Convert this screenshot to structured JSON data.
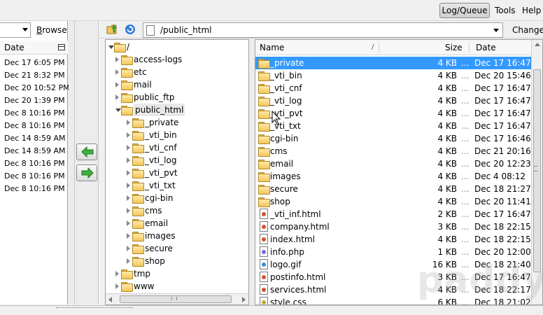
{
  "toolbar": {
    "log_queue_label": "Log/Queue",
    "tools_label": "Tools",
    "help_label": "Help"
  },
  "local_pane": {
    "browse_label": "Browse",
    "date_header": "Date",
    "dates": [
      "Dec 17 6:05 PM",
      "Dec 21 8:32 PM",
      "Dec 20 10:52 PM",
      "Dec 20 1:39 PM",
      "Dec 8 10:16 PM",
      "Dec 8 10:16 PM",
      "Dec 14 8:59 AM",
      "Dec 14 8:59 AM",
      "Dec 8 10:16 PM",
      "Dec 8 10:16 PM",
      "Dec 8 10:16 PM"
    ]
  },
  "remote": {
    "path": "/public_html",
    "change_label": "Change"
  },
  "tree": {
    "root": "/",
    "items": [
      {
        "label": "access-logs"
      },
      {
        "label": "etc"
      },
      {
        "label": "mail"
      },
      {
        "label": "public_ftp"
      },
      {
        "label": "public_html"
      },
      {
        "label": "_private"
      },
      {
        "label": "_vti_bin"
      },
      {
        "label": "_vti_cnf"
      },
      {
        "label": "_vti_log"
      },
      {
        "label": "_vti_pvt"
      },
      {
        "label": "_vti_txt"
      },
      {
        "label": "cgi-bin"
      },
      {
        "label": "cms"
      },
      {
        "label": "email"
      },
      {
        "label": "images"
      },
      {
        "label": "secure"
      },
      {
        "label": "shop"
      },
      {
        "label": "tmp"
      },
      {
        "label": "www"
      }
    ]
  },
  "file_list": {
    "headers": {
      "name": "Name",
      "size": "Size",
      "date": "Date",
      "sort_mark": "/"
    },
    "rows": [
      {
        "name": "_private",
        "size": "4 KB",
        "date": "Dec 17 16:47",
        "type": "folder"
      },
      {
        "name": "_vti_bin",
        "size": "4 KB",
        "date": "Dec 20 15:46",
        "type": "folder"
      },
      {
        "name": "_vti_cnf",
        "size": "4 KB",
        "date": "Dec 17 16:47",
        "type": "folder"
      },
      {
        "name": "_vti_log",
        "size": "4 KB",
        "date": "Dec 17 16:47",
        "type": "folder"
      },
      {
        "name": "_vti_pvt",
        "size": "4 KB",
        "date": "Dec 17 16:47",
        "type": "folder"
      },
      {
        "name": "_vti_txt",
        "size": "4 KB",
        "date": "Dec 17 16:47",
        "type": "folder"
      },
      {
        "name": "cgi-bin",
        "size": "4 KB",
        "date": "Dec 17 16:46",
        "type": "folder"
      },
      {
        "name": "cms",
        "size": "4 KB",
        "date": "Dec 21 20:16",
        "type": "folder"
      },
      {
        "name": "email",
        "size": "4 KB",
        "date": "Dec 20 12:23",
        "type": "folder"
      },
      {
        "name": "images",
        "size": "4 KB",
        "date": "Dec 4 08:12",
        "type": "folder"
      },
      {
        "name": "secure",
        "size": "4 KB",
        "date": "Dec 18 21:27",
        "type": "folder"
      },
      {
        "name": "shop",
        "size": "4 KB",
        "date": "Dec 20 11:41",
        "type": "folder"
      },
      {
        "name": "_vti_inf.html",
        "size": "2 KB",
        "date": "Dec 17 16:47",
        "type": "html"
      },
      {
        "name": "company.html",
        "size": "3 KB",
        "date": "Dec 18 22:15",
        "type": "html"
      },
      {
        "name": "index.html",
        "size": "4 KB",
        "date": "Dec 18 22:15",
        "type": "html"
      },
      {
        "name": "info.php",
        "size": "1 KB",
        "date": "Dec 20 12:00",
        "type": "php"
      },
      {
        "name": "logo.gif",
        "size": "16 KB",
        "date": "Dec 18 21:40",
        "type": "image"
      },
      {
        "name": "postinfo.html",
        "size": "3 KB",
        "date": "Dec 17 16:47",
        "type": "html"
      },
      {
        "name": "services.html",
        "size": "4 KB",
        "date": "Dec 18 22:17",
        "type": "html"
      },
      {
        "name": "style.css",
        "size": "6 KB",
        "date": "Dec 18 21:02",
        "type": "css"
      }
    ],
    "ellipsis": "..."
  }
}
